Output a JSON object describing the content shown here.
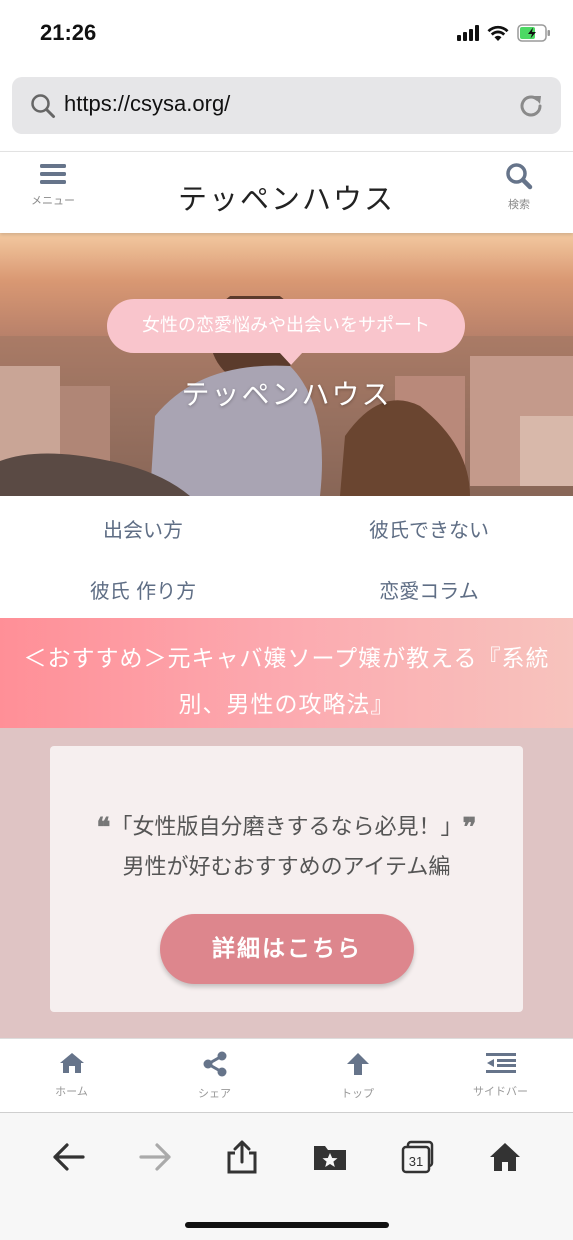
{
  "status_bar": {
    "time": "21:26"
  },
  "browser": {
    "url": "https://csysa.org/"
  },
  "header": {
    "title": "テッペンハウス",
    "menu_label": "メニュー",
    "search_label": "検索"
  },
  "hero": {
    "tagline": "女性の恋愛悩みや出会いをサポート",
    "site_name": "テッペンハウス"
  },
  "nav": {
    "items": [
      "出会い方",
      "彼氏できない",
      "彼氏 作り方",
      "恋愛コラム"
    ]
  },
  "banner": {
    "line1": "＜おすすめ＞元キャバ嬢ソープ嬢が教える『系統",
    "line2": "別、男性の攻略法』"
  },
  "card": {
    "quote_line1": "「女性版自分磨きするなら必見！」",
    "quote_line2": "男性が好むおすすめのアイテム編",
    "button": "詳細はこちら"
  },
  "footer_nav": {
    "home": "ホーム",
    "share": "シェア",
    "top": "トップ",
    "sidebar": "サイドバー"
  },
  "toolbar": {
    "tabs_count": "31"
  },
  "colors": {
    "accent_pink": "#f9c5cc",
    "button_pink": "#dd868d",
    "section_bg": "#dfc4c4",
    "nav_text": "#5f6e85",
    "icon_gray": "#66748a"
  }
}
